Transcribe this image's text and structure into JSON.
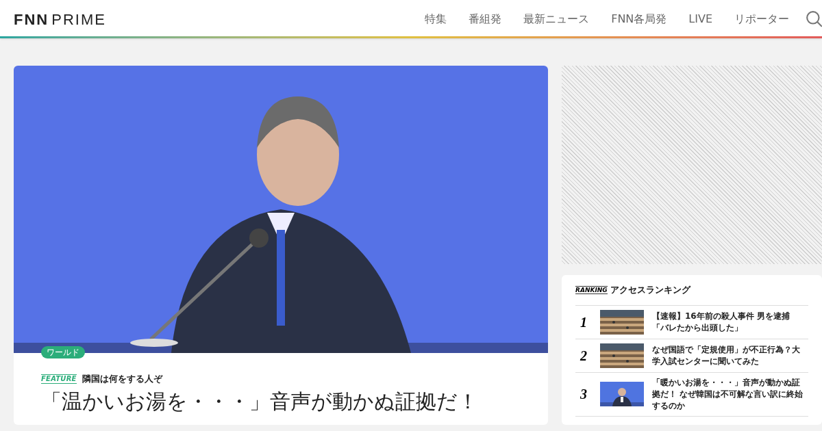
{
  "header": {
    "logo_bold": "FNN",
    "logo_light": "PRIME",
    "nav": [
      {
        "label": "特集"
      },
      {
        "label": "番組発"
      },
      {
        "label": "最新ニュース"
      },
      {
        "label": "FNN各局発"
      },
      {
        "label": "LIVE"
      },
      {
        "label": "リポーター"
      }
    ]
  },
  "article": {
    "category": "ワールド",
    "feature_label": "FEATURE",
    "series": "隣国は何をする人ぞ",
    "headline": "「温かいお湯を・・・」音声が動かぬ証拠だ！"
  },
  "ranking": {
    "label": "RANKING",
    "title": "アクセスランキング",
    "items": [
      {
        "rank": "1",
        "title": "【速報】16年前の殺人事件 男を逮捕「バレたから出頭した」"
      },
      {
        "rank": "2",
        "title": "なぜ国語で「定規使用」が不正行為？大学入試センターに聞いてみた"
      },
      {
        "rank": "3",
        "title": "「暖かいお湯を・・・」音声が動かぬ証拠だ！ なぜ韓国は不可解な言い訳に終始するのか"
      }
    ]
  }
}
